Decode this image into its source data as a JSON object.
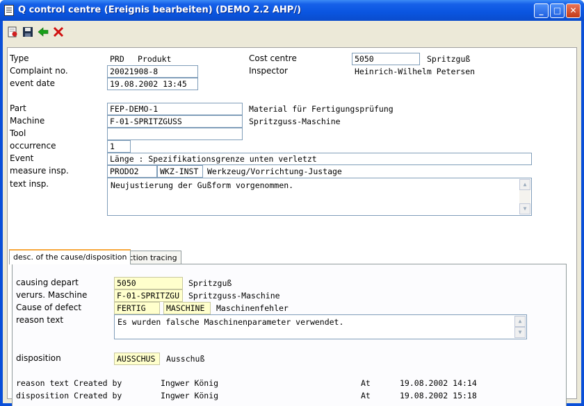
{
  "window": {
    "title": "Q control centre (Ereignis bearbeiten) (DEMO 2.2 AHP/)",
    "minimize": "_",
    "maximize": "□",
    "close": "✕"
  },
  "toolbar": {
    "icons": [
      "new-record-icon",
      "save-icon",
      "back-arrow-icon",
      "delete-icon"
    ],
    "colors": {
      "back": "#1aa01a",
      "delete": "#d01010"
    }
  },
  "header": {
    "type_label": "Type",
    "type_code": "PRD",
    "type_text": "Produkt",
    "cost_centre_label": "Cost centre",
    "cost_centre_value": "5050",
    "cost_centre_text": "Spritzguß",
    "complaint_label": "Complaint no.",
    "complaint_value": "20021908-8",
    "inspector_label": "Inspector",
    "inspector_value": "Heinrich-Wilhelm Petersen",
    "event_date_label": "event date",
    "event_date_value": "19.08.2002 13:45"
  },
  "details": {
    "part_label": "Part",
    "part_value": "FEP-DEMO-1",
    "part_text": "Material für Fertigungsprüfung",
    "machine_label": "Machine",
    "machine_value": "F-01-SPRITZGUSS",
    "machine_text": "Spritzguss-Maschine",
    "tool_label": "Tool",
    "tool_value": "",
    "occurrence_label": "occurrence",
    "occurrence_value": "1",
    "event_label": "Event",
    "event_value": "Länge : Spezifikationsgrenze unten verletzt",
    "measure_label": "measure insp.",
    "measure_code1": "PRODO2",
    "measure_code2": "WKZ-INST",
    "measure_text": "Werkzeug/Vorrichtung-Justage",
    "text_label": "text insp.",
    "text_value": "Neujustierung der Gußform vorgenommen."
  },
  "tabs": [
    {
      "label": "desc. of the cause/disposition",
      "active": true
    },
    {
      "label": "Action tracing",
      "active": false
    }
  ],
  "cause": {
    "depart_label": "causing depart",
    "depart_value": "5050",
    "depart_text": "Spritzguß",
    "machine_label": "verurs. Maschine",
    "machine_value": "F-01-SPRITZGU",
    "machine_text": "Spritzguss-Maschine",
    "defect_label": "Cause of defect",
    "defect_code1": "FERTIG",
    "defect_code2": "MASCHINE",
    "defect_text": "Maschinenfehler",
    "reason_label": "reason text",
    "reason_value": "Es wurden falsche Maschinenparameter verwendet.",
    "disposition_label": "disposition",
    "disposition_value": "AUSSCHUS",
    "disposition_text": "Ausschuß"
  },
  "audit": [
    {
      "label": "reason text Created by",
      "user": "Ingwer König",
      "at_label": "At",
      "date": "19.08.2002 14:14"
    },
    {
      "label": "disposition Created by",
      "user": "Ingwer König",
      "at_label": "At",
      "date": "19.08.2002 15:18"
    }
  ]
}
